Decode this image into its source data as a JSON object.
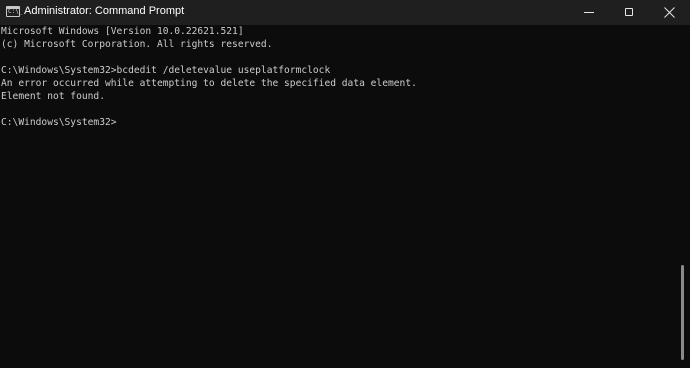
{
  "window": {
    "title": "Administrator: Command Prompt",
    "icon": "cmd-icon",
    "prompt_icon_glyph": "C:\\_",
    "controls": {
      "minimize_icon": "minimize-icon",
      "maximize_icon": "maximize-icon",
      "close_icon": "close-icon"
    }
  },
  "console": {
    "background": "#0c0c0c",
    "foreground": "#cccccc",
    "lines": [
      "Microsoft Windows [Version 10.0.22621.521]",
      "(c) Microsoft Corporation. All rights reserved.",
      "",
      "C:\\Windows\\System32>bcdedit /deletevalue useplatformclock",
      "An error occurred while attempting to delete the specified data element.",
      "Element not found.",
      "",
      "C:\\Windows\\System32>"
    ]
  }
}
